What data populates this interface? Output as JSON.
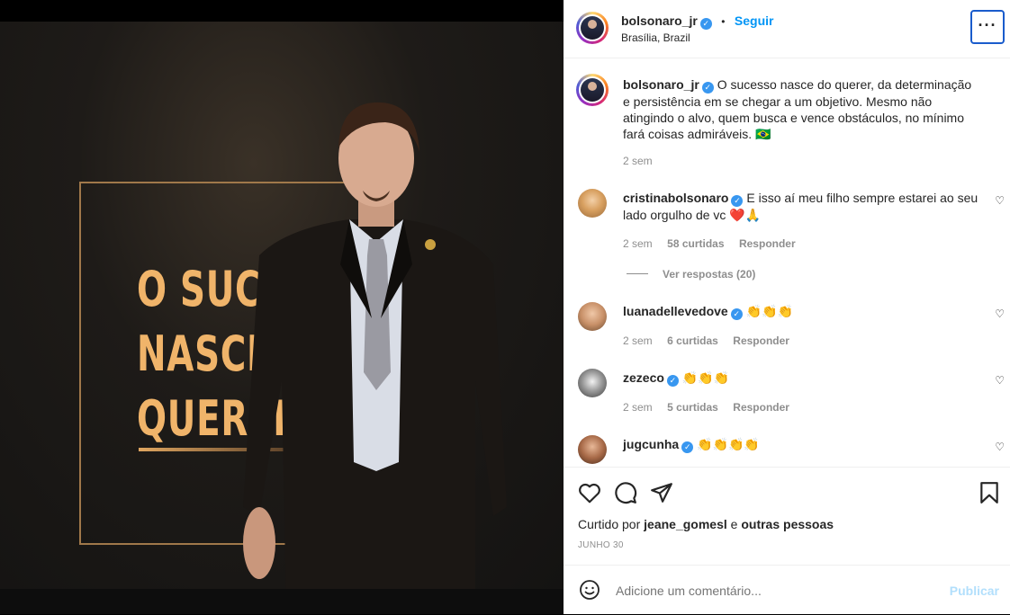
{
  "post": {
    "slogan_lines": [
      "O SUCESSO",
      "NASCE DO",
      "QUERER."
    ]
  },
  "header": {
    "username": "bolsonaro_jr",
    "separator": "•",
    "follow_label": "Seguir",
    "location": "Brasília, Brazil",
    "more_label": "···"
  },
  "caption": {
    "username": "bolsonaro_jr",
    "text": "O sucesso nasce do querer, da determinação e persistência em se chegar a um objetivo. Mesmo não atingindo o alvo, quem busca e vence obstáculos, no mínimo fará coisas admiráveis. 🇧🇷",
    "time": "2 sem"
  },
  "comments": [
    {
      "username": "cristinabolsonaro",
      "text": "E isso aí meu filho sempre estarei ao seu lado orgulho de vc ❤️🙏",
      "time": "2 sem",
      "likes": "58 curtidas",
      "reply": "Responder",
      "view_replies": "Ver respostas (20)"
    },
    {
      "username": "luanadellevedove",
      "text": "👏👏👏",
      "time": "2 sem",
      "likes": "6 curtidas",
      "reply": "Responder"
    },
    {
      "username": "zezeco",
      "text": "👏👏👏",
      "time": "2 sem",
      "likes": "5 curtidas",
      "reply": "Responder"
    },
    {
      "username": "jugcunha",
      "text": "👏👏👏👏"
    }
  ],
  "likes": {
    "prefix": "Curtido por",
    "user": "jeane_gomesl",
    "conj": "e",
    "others": "outras pessoas"
  },
  "date": "JUNHO 30",
  "add_comment": {
    "placeholder": "Adicione um comentário...",
    "publish_label": "Publicar"
  },
  "colors": {
    "accent": "#0095f6",
    "verified": "#3897f0",
    "slogan": "#f0b46a"
  }
}
